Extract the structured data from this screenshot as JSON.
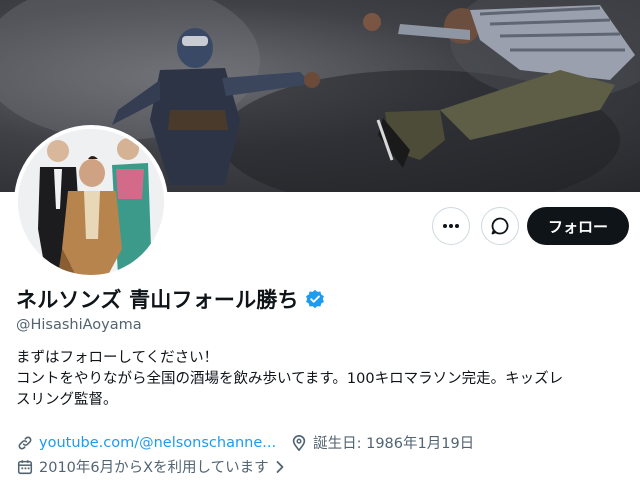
{
  "profile": {
    "display_name": "ネルソンズ 青山フォール勝ち",
    "handle": "@HisashiAoyama",
    "bio_lines": [
      "まずはフォローしてください！",
      "コントをやりながら全国の酒場を飲み歩いてます。100キロマラソン完走。キッズレ",
      "スリング監督。"
    ],
    "website": "youtube.com/@nelsonschanne...",
    "birthday": "誕生日: 1986年1月19日",
    "joined": "2010年6月からXを利用しています"
  },
  "actions": {
    "follow_label": "フォロー"
  },
  "icons": {
    "more": "more-icon",
    "message": "message-icon",
    "verified": "verified-badge-icon",
    "link": "link-icon",
    "birthday": "location-pin-icon",
    "calendar": "calendar-icon",
    "chevron": "chevron-right-icon"
  },
  "colors": {
    "verified_blue": "#1d9bf0",
    "link_blue": "#1d9bf0",
    "follow_bg": "#0f1419",
    "secondary_text": "#536471"
  }
}
